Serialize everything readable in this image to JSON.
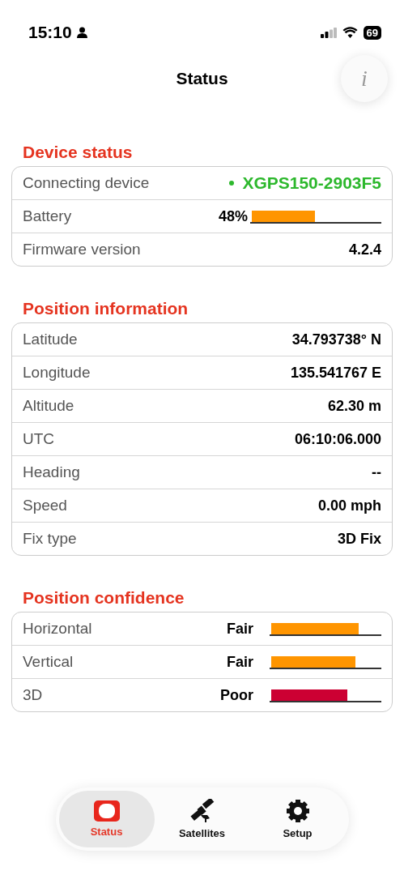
{
  "status_bar": {
    "time": "15:10",
    "battery": "69"
  },
  "header": {
    "title": "Status",
    "info_button": "i"
  },
  "sections": [
    {
      "title": "Device status",
      "rows": [
        {
          "kind": "device",
          "label": "Connecting device",
          "value": "XGPS150-2903F5",
          "color": "#2db82d"
        },
        {
          "kind": "bar",
          "label": "Battery",
          "value": "48%",
          "level": 0.48,
          "color": "#ff9500"
        },
        {
          "kind": "text",
          "label": "Firmware version",
          "value": "4.2.4"
        }
      ]
    },
    {
      "title": "Position information",
      "rows": [
        {
          "kind": "text",
          "label": "Latitude",
          "value": "34.793738° N"
        },
        {
          "kind": "text",
          "label": "Longitude",
          "value": "135.541767 E"
        },
        {
          "kind": "text",
          "label": "Altitude",
          "value": "62.30 m"
        },
        {
          "kind": "text",
          "label": "UTC",
          "value": "06:10:06.000"
        },
        {
          "kind": "text",
          "label": "Heading",
          "value": "--"
        },
        {
          "kind": "text",
          "label": "Speed",
          "value": "0.00 mph"
        },
        {
          "kind": "text",
          "label": "Fix type",
          "value": "3D Fix"
        }
      ]
    },
    {
      "title": "Position confidence",
      "rows": [
        {
          "kind": "confidence",
          "label": "Horizontal",
          "value": "Fair",
          "level": 0.78,
          "color": "#ff9500"
        },
        {
          "kind": "confidence",
          "label": "Vertical",
          "value": "Fair",
          "level": 0.75,
          "color": "#ff9500"
        },
        {
          "kind": "confidence",
          "label": "3D",
          "value": "Poor",
          "level": 0.68,
          "color": "#cc0033"
        }
      ]
    }
  ],
  "tabs": [
    {
      "label": "Status",
      "kind": "status",
      "selected": true
    },
    {
      "label": "Satellites",
      "kind": "satellite",
      "selected": false
    },
    {
      "label": "Setup",
      "kind": "gear",
      "selected": false
    }
  ]
}
